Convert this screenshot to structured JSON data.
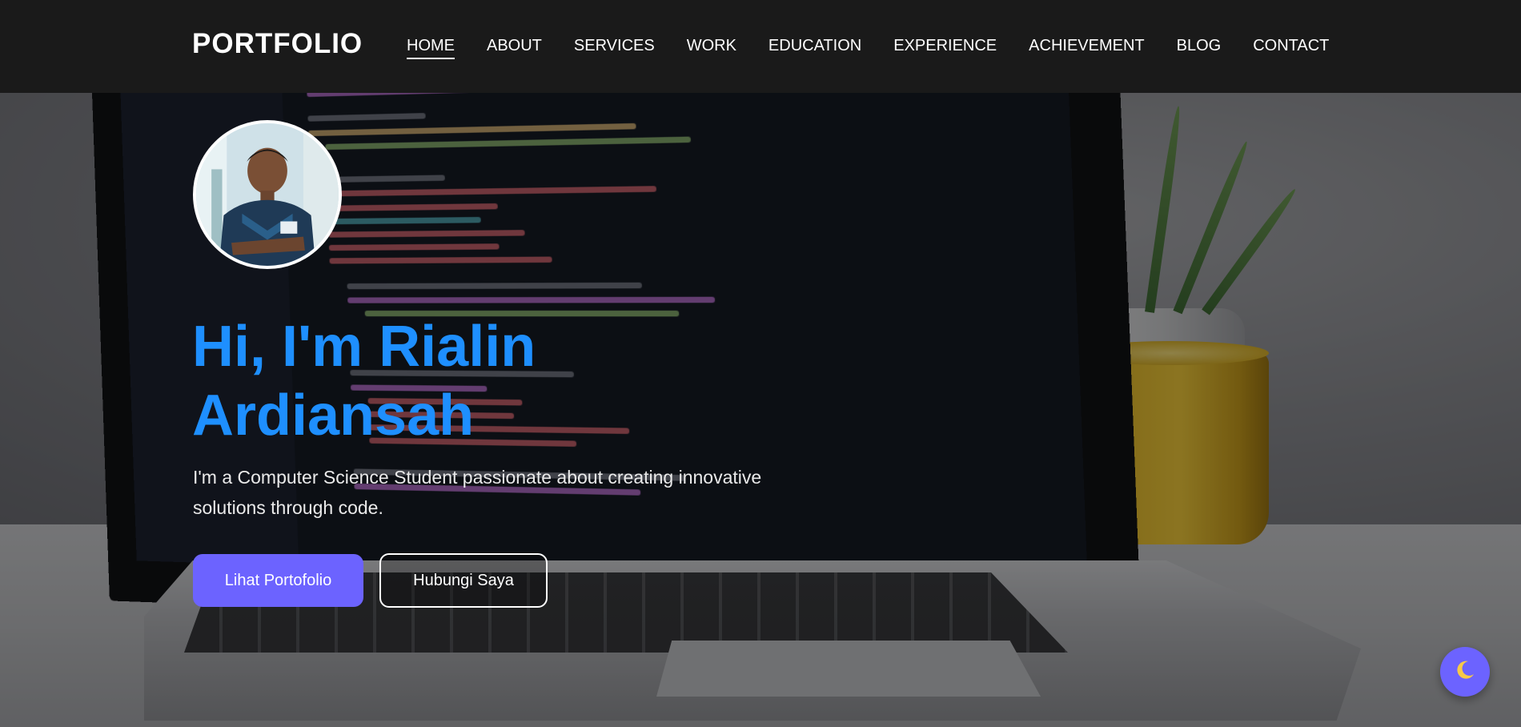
{
  "brand": {
    "logo": "PORTFOLIO"
  },
  "nav": {
    "items": [
      {
        "label": "HOME",
        "active": true
      },
      {
        "label": "ABOUT"
      },
      {
        "label": "SERVICES"
      },
      {
        "label": "WORK"
      },
      {
        "label": "EDUCATION"
      },
      {
        "label": "EXPERIENCE"
      },
      {
        "label": "ACHIEVEMENT"
      },
      {
        "label": "BLOG"
      },
      {
        "label": "CONTACT"
      }
    ]
  },
  "hero": {
    "title_line1": "Hi, I'm Rialin",
    "title_line2": "Ardiansah",
    "subtitle": "I'm a Computer Science Student passionate about creating innovative solutions through code.",
    "primary_button": "Lihat Portofolio",
    "secondary_button": "Hubungi Saya"
  },
  "theme_toggle": {
    "icon": "moon-icon"
  },
  "colors": {
    "accent": "#6c63ff",
    "title": "#1e8fff",
    "navbar": "#1a1a1a"
  }
}
